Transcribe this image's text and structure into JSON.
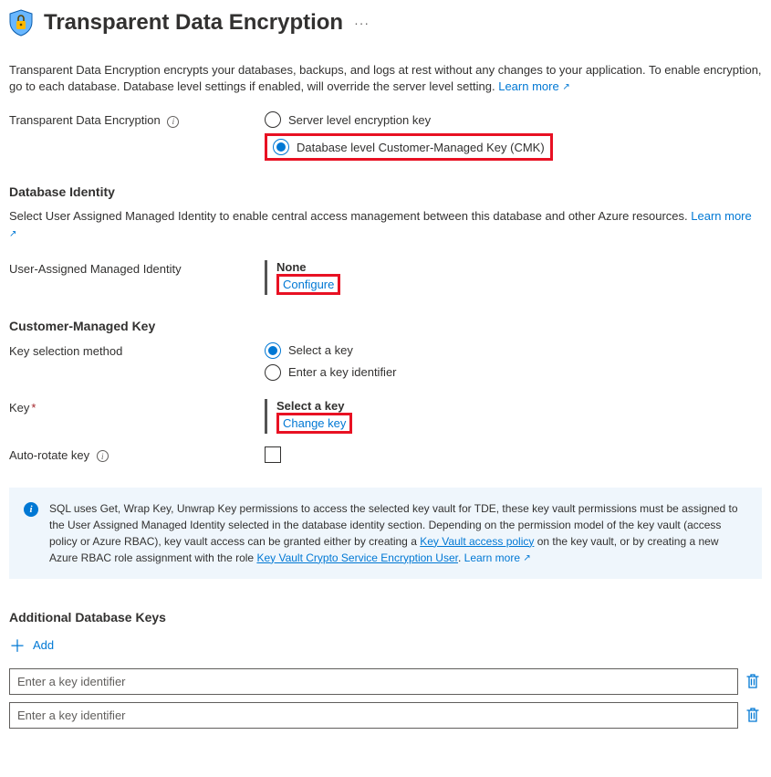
{
  "header": {
    "title": "Transparent Data Encryption"
  },
  "description": {
    "text": "Transparent Data Encryption encrypts your databases, backups, and logs at rest without any changes to your application. To enable encryption, go to each database. Database level settings if enabled, will override the server level setting.",
    "learn_more": "Learn more"
  },
  "tde": {
    "label": "Transparent Data Encryption",
    "option1": "Server level encryption key",
    "option2": "Database level Customer-Managed Key (CMK)"
  },
  "db_identity": {
    "title": "Database Identity",
    "desc": "Select User Assigned Managed Identity to enable central access management between this database and other Azure resources.",
    "learn_more": "Learn more"
  },
  "uami": {
    "label": "User-Assigned Managed Identity",
    "value": "None",
    "configure": "Configure"
  },
  "cmk": {
    "title": "Customer-Managed Key",
    "selection_label": "Key selection method",
    "select_key": "Select a key",
    "enter_id": "Enter a key identifier",
    "key_label": "Key",
    "key_value": "Select a key",
    "change_key": "Change key",
    "auto_rotate_label": "Auto-rotate key"
  },
  "infobox": {
    "p1": "SQL uses Get, Wrap Key, Unwrap Key permissions to access the selected key vault for TDE, these key vault permissions must be assigned to the User Assigned Managed Identity selected in the database identity section. Depending on the permission model of the key vault (access policy or Azure RBAC), key vault access can be granted either by creating a ",
    "link1": "Key Vault access policy",
    "p2": " on the key vault, or by creating a new Azure RBAC role assignment with the role ",
    "link2": "Key Vault Crypto Service Encryption User",
    "p3": ". ",
    "learn_more": "Learn more"
  },
  "additional_keys": {
    "title": "Additional Database Keys",
    "add": "Add",
    "placeholder": "Enter a key identifier"
  }
}
